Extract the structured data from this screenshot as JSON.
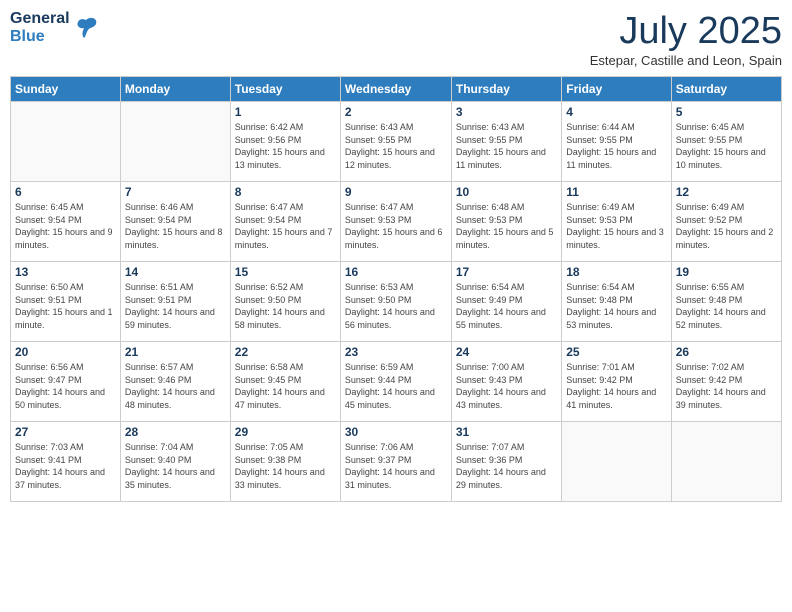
{
  "header": {
    "logo": {
      "general": "General",
      "blue": "Blue"
    },
    "title": "July 2025",
    "location": "Estepar, Castille and Leon, Spain"
  },
  "weekdays": [
    "Sunday",
    "Monday",
    "Tuesday",
    "Wednesday",
    "Thursday",
    "Friday",
    "Saturday"
  ],
  "weeks": [
    [
      {
        "day": "",
        "sunrise": "",
        "sunset": "",
        "daylight": "",
        "empty": true
      },
      {
        "day": "",
        "sunrise": "",
        "sunset": "",
        "daylight": "",
        "empty": true
      },
      {
        "day": "1",
        "sunrise": "Sunrise: 6:42 AM",
        "sunset": "Sunset: 9:56 PM",
        "daylight": "Daylight: 15 hours and 13 minutes."
      },
      {
        "day": "2",
        "sunrise": "Sunrise: 6:43 AM",
        "sunset": "Sunset: 9:55 PM",
        "daylight": "Daylight: 15 hours and 12 minutes."
      },
      {
        "day": "3",
        "sunrise": "Sunrise: 6:43 AM",
        "sunset": "Sunset: 9:55 PM",
        "daylight": "Daylight: 15 hours and 11 minutes."
      },
      {
        "day": "4",
        "sunrise": "Sunrise: 6:44 AM",
        "sunset": "Sunset: 9:55 PM",
        "daylight": "Daylight: 15 hours and 11 minutes."
      },
      {
        "day": "5",
        "sunrise": "Sunrise: 6:45 AM",
        "sunset": "Sunset: 9:55 PM",
        "daylight": "Daylight: 15 hours and 10 minutes."
      }
    ],
    [
      {
        "day": "6",
        "sunrise": "Sunrise: 6:45 AM",
        "sunset": "Sunset: 9:54 PM",
        "daylight": "Daylight: 15 hours and 9 minutes."
      },
      {
        "day": "7",
        "sunrise": "Sunrise: 6:46 AM",
        "sunset": "Sunset: 9:54 PM",
        "daylight": "Daylight: 15 hours and 8 minutes."
      },
      {
        "day": "8",
        "sunrise": "Sunrise: 6:47 AM",
        "sunset": "Sunset: 9:54 PM",
        "daylight": "Daylight: 15 hours and 7 minutes."
      },
      {
        "day": "9",
        "sunrise": "Sunrise: 6:47 AM",
        "sunset": "Sunset: 9:53 PM",
        "daylight": "Daylight: 15 hours and 6 minutes."
      },
      {
        "day": "10",
        "sunrise": "Sunrise: 6:48 AM",
        "sunset": "Sunset: 9:53 PM",
        "daylight": "Daylight: 15 hours and 5 minutes."
      },
      {
        "day": "11",
        "sunrise": "Sunrise: 6:49 AM",
        "sunset": "Sunset: 9:53 PM",
        "daylight": "Daylight: 15 hours and 3 minutes."
      },
      {
        "day": "12",
        "sunrise": "Sunrise: 6:49 AM",
        "sunset": "Sunset: 9:52 PM",
        "daylight": "Daylight: 15 hours and 2 minutes."
      }
    ],
    [
      {
        "day": "13",
        "sunrise": "Sunrise: 6:50 AM",
        "sunset": "Sunset: 9:51 PM",
        "daylight": "Daylight: 15 hours and 1 minute."
      },
      {
        "day": "14",
        "sunrise": "Sunrise: 6:51 AM",
        "sunset": "Sunset: 9:51 PM",
        "daylight": "Daylight: 14 hours and 59 minutes."
      },
      {
        "day": "15",
        "sunrise": "Sunrise: 6:52 AM",
        "sunset": "Sunset: 9:50 PM",
        "daylight": "Daylight: 14 hours and 58 minutes."
      },
      {
        "day": "16",
        "sunrise": "Sunrise: 6:53 AM",
        "sunset": "Sunset: 9:50 PM",
        "daylight": "Daylight: 14 hours and 56 minutes."
      },
      {
        "day": "17",
        "sunrise": "Sunrise: 6:54 AM",
        "sunset": "Sunset: 9:49 PM",
        "daylight": "Daylight: 14 hours and 55 minutes."
      },
      {
        "day": "18",
        "sunrise": "Sunrise: 6:54 AM",
        "sunset": "Sunset: 9:48 PM",
        "daylight": "Daylight: 14 hours and 53 minutes."
      },
      {
        "day": "19",
        "sunrise": "Sunrise: 6:55 AM",
        "sunset": "Sunset: 9:48 PM",
        "daylight": "Daylight: 14 hours and 52 minutes."
      }
    ],
    [
      {
        "day": "20",
        "sunrise": "Sunrise: 6:56 AM",
        "sunset": "Sunset: 9:47 PM",
        "daylight": "Daylight: 14 hours and 50 minutes."
      },
      {
        "day": "21",
        "sunrise": "Sunrise: 6:57 AM",
        "sunset": "Sunset: 9:46 PM",
        "daylight": "Daylight: 14 hours and 48 minutes."
      },
      {
        "day": "22",
        "sunrise": "Sunrise: 6:58 AM",
        "sunset": "Sunset: 9:45 PM",
        "daylight": "Daylight: 14 hours and 47 minutes."
      },
      {
        "day": "23",
        "sunrise": "Sunrise: 6:59 AM",
        "sunset": "Sunset: 9:44 PM",
        "daylight": "Daylight: 14 hours and 45 minutes."
      },
      {
        "day": "24",
        "sunrise": "Sunrise: 7:00 AM",
        "sunset": "Sunset: 9:43 PM",
        "daylight": "Daylight: 14 hours and 43 minutes."
      },
      {
        "day": "25",
        "sunrise": "Sunrise: 7:01 AM",
        "sunset": "Sunset: 9:42 PM",
        "daylight": "Daylight: 14 hours and 41 minutes."
      },
      {
        "day": "26",
        "sunrise": "Sunrise: 7:02 AM",
        "sunset": "Sunset: 9:42 PM",
        "daylight": "Daylight: 14 hours and 39 minutes."
      }
    ],
    [
      {
        "day": "27",
        "sunrise": "Sunrise: 7:03 AM",
        "sunset": "Sunset: 9:41 PM",
        "daylight": "Daylight: 14 hours and 37 minutes."
      },
      {
        "day": "28",
        "sunrise": "Sunrise: 7:04 AM",
        "sunset": "Sunset: 9:40 PM",
        "daylight": "Daylight: 14 hours and 35 minutes."
      },
      {
        "day": "29",
        "sunrise": "Sunrise: 7:05 AM",
        "sunset": "Sunset: 9:38 PM",
        "daylight": "Daylight: 14 hours and 33 minutes."
      },
      {
        "day": "30",
        "sunrise": "Sunrise: 7:06 AM",
        "sunset": "Sunset: 9:37 PM",
        "daylight": "Daylight: 14 hours and 31 minutes."
      },
      {
        "day": "31",
        "sunrise": "Sunrise: 7:07 AM",
        "sunset": "Sunset: 9:36 PM",
        "daylight": "Daylight: 14 hours and 29 minutes."
      },
      {
        "day": "",
        "sunrise": "",
        "sunset": "",
        "daylight": "",
        "empty": true
      },
      {
        "day": "",
        "sunrise": "",
        "sunset": "",
        "daylight": "",
        "empty": true
      }
    ]
  ]
}
